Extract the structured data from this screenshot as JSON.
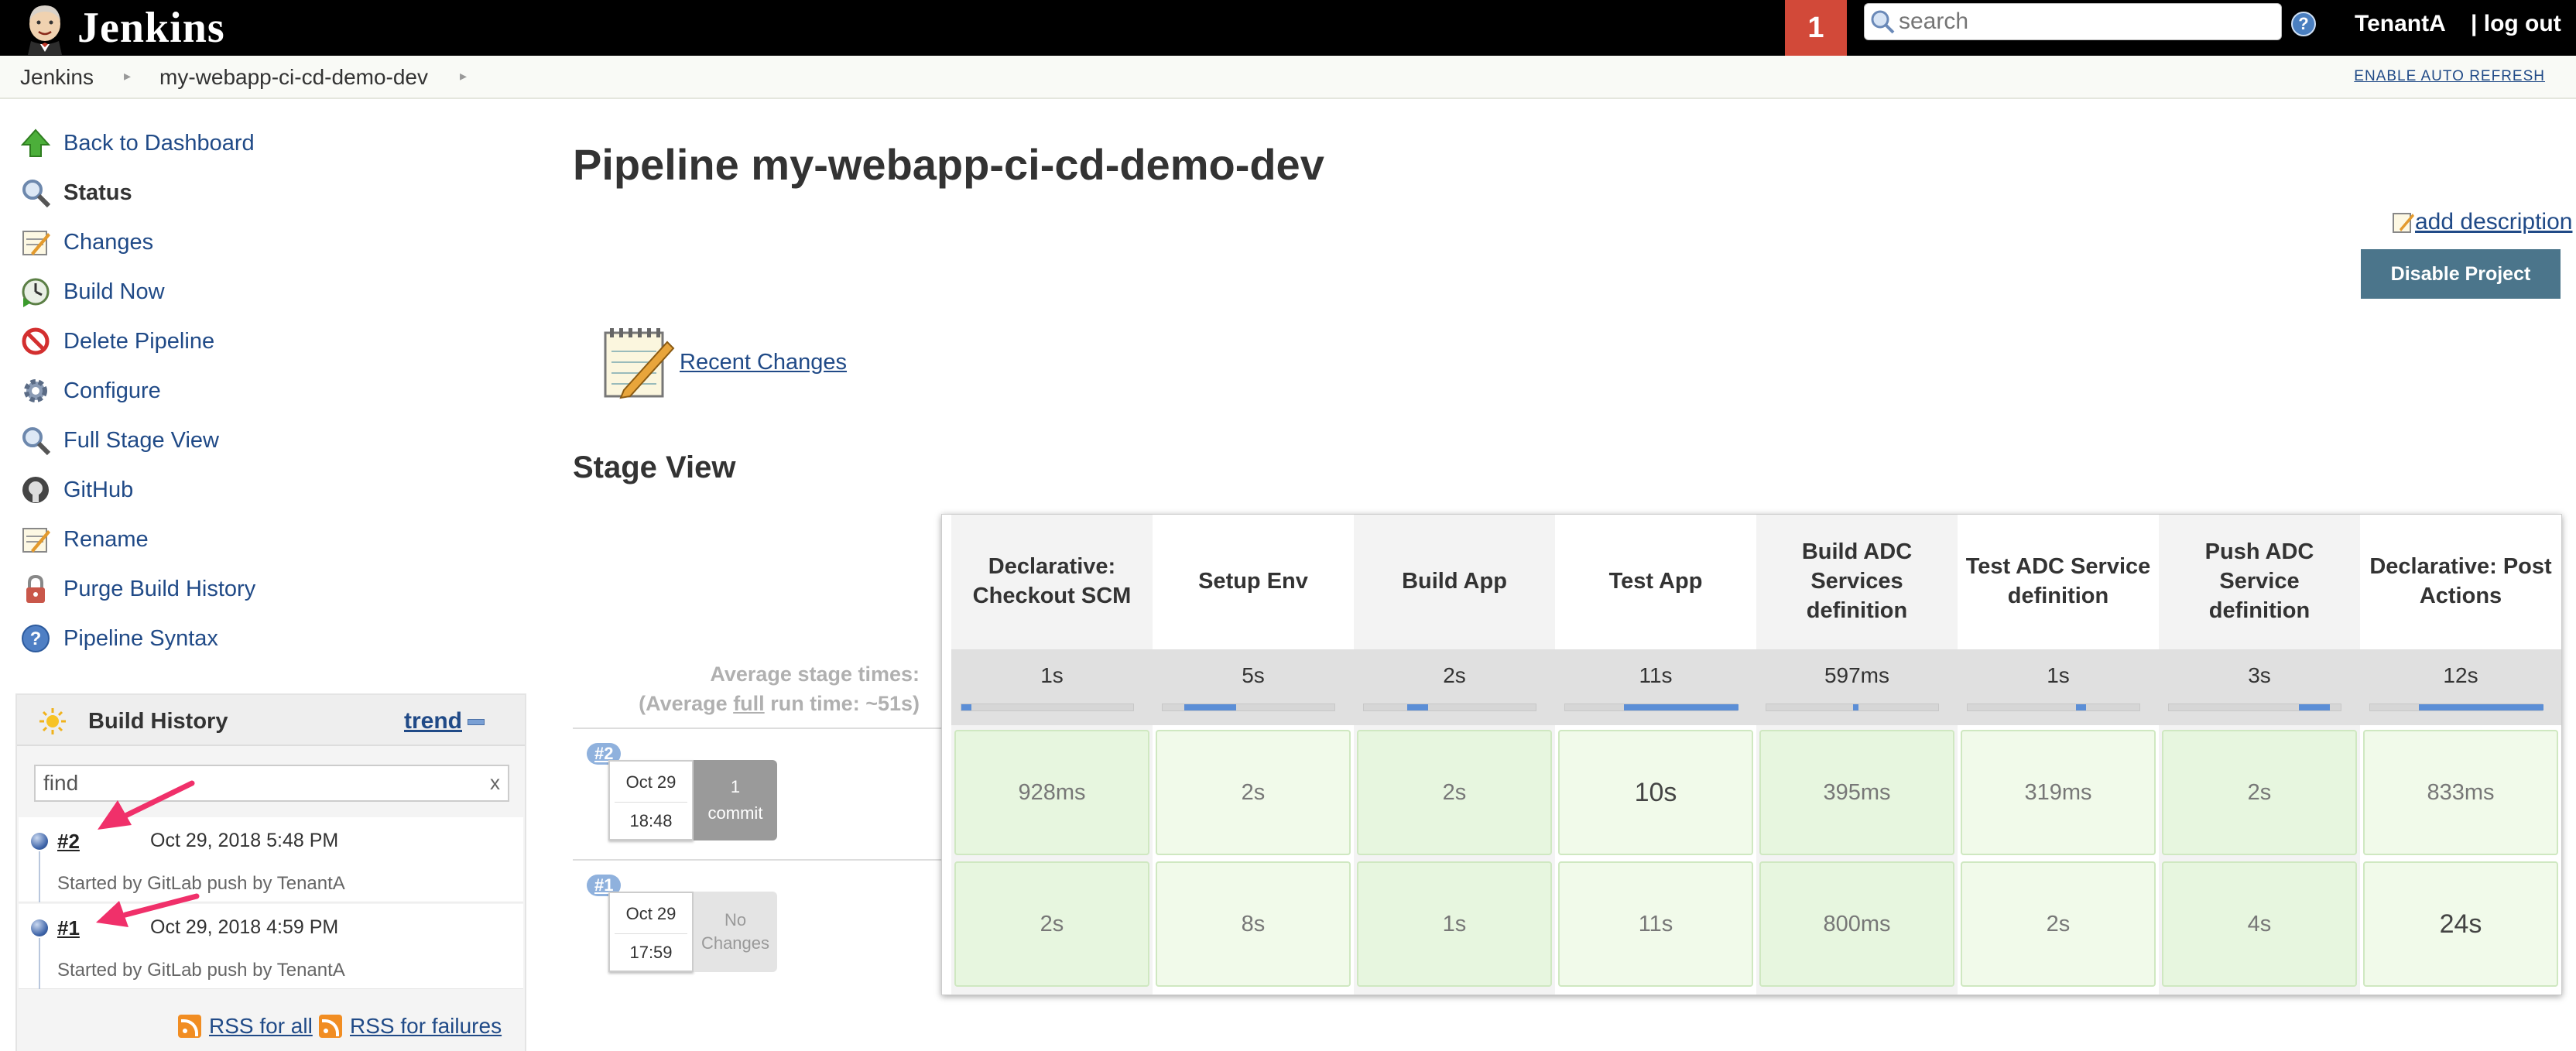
{
  "header": {
    "brand": "Jenkins",
    "notification_count": "1",
    "search_placeholder": "search",
    "help_label": "?",
    "user": "TenantA",
    "logout": "log out"
  },
  "breadcrumb": {
    "items": [
      "Jenkins",
      "my-webapp-ci-cd-demo-dev"
    ],
    "auto_refresh": "ENABLE AUTO REFRESH"
  },
  "sidebar": {
    "tasks": [
      {
        "label": "Back to Dashboard",
        "icon": "up-arrow-icon"
      },
      {
        "label": "Status",
        "icon": "magnifier-icon"
      },
      {
        "label": "Changes",
        "icon": "notepad-icon"
      },
      {
        "label": "Build Now",
        "icon": "clock-play-icon"
      },
      {
        "label": "Delete Pipeline",
        "icon": "no-entry-icon"
      },
      {
        "label": "Configure",
        "icon": "gear-icon"
      },
      {
        "label": "Full Stage View",
        "icon": "magnifier-icon"
      },
      {
        "label": "GitHub",
        "icon": "github-icon"
      },
      {
        "label": "Rename",
        "icon": "notepad-icon"
      },
      {
        "label": "Purge Build History",
        "icon": "lock-icon"
      },
      {
        "label": "Pipeline Syntax",
        "icon": "help-icon"
      }
    ]
  },
  "build_history": {
    "title": "Build History",
    "trend": "trend",
    "find_value": "find",
    "find_clear": "x",
    "builds": [
      {
        "number": "#2",
        "date": "Oct 29, 2018 5:48 PM",
        "cause": "Started by GitLab push by TenantA"
      },
      {
        "number": "#1",
        "date": "Oct 29, 2018 4:59 PM",
        "cause": "Started by GitLab push by TenantA"
      }
    ],
    "rss_all": "RSS for all",
    "rss_failures": "RSS for failures"
  },
  "main": {
    "title": "Pipeline my-webapp-ci-cd-demo-dev",
    "add_description": "add description",
    "disable_button": "Disable Project",
    "recent_changes": "Recent Changes",
    "stage_view_title": "Stage View",
    "avg_line1": "Average stage times:",
    "avg_line2_pre": "(Average ",
    "avg_line2_u": "full",
    "avg_line2_post": " run time: ~51s)"
  },
  "stage_view": {
    "stages": [
      {
        "name": "Declarative: Checkout SCM",
        "avg": "1s",
        "avg_bar_fraction": 0.02
      },
      {
        "name": "Setup Env",
        "avg": "5s",
        "avg_bar_fraction": 0.1
      },
      {
        "name": "Build App",
        "avg": "2s",
        "avg_bar_fraction": 0.04
      },
      {
        "name": "Test App",
        "avg": "11s",
        "avg_bar_fraction": 0.22
      },
      {
        "name": "Build ADC Services definition",
        "avg": "597ms",
        "avg_bar_fraction": 0.01
      },
      {
        "name": "Test ADC Service definition",
        "avg": "1s",
        "avg_bar_fraction": 0.02
      },
      {
        "name": "Push ADC Service definition",
        "avg": "3s",
        "avg_bar_fraction": 0.06
      },
      {
        "name": "Declarative: Post Actions",
        "avg": "12s",
        "avg_bar_fraction": 0.24
      }
    ],
    "runs": [
      {
        "badge": "#2",
        "date": "Oct 29",
        "time": "18:48",
        "changes": [
          "1",
          "commit"
        ],
        "changes_style": "dark",
        "durations": [
          "928ms",
          "2s",
          "2s",
          "10s",
          "395ms",
          "319ms",
          "2s",
          "833ms"
        ]
      },
      {
        "badge": "#1",
        "date": "Oct 29",
        "time": "17:59",
        "changes": [
          "No",
          "Changes"
        ],
        "changes_style": "light",
        "durations": [
          "2s",
          "8s",
          "1s",
          "11s",
          "800ms",
          "2s",
          "4s",
          "24s"
        ]
      }
    ]
  },
  "colors": {
    "header_bg": "#000000",
    "notification_bg": "#d24939",
    "link": "#204a87",
    "stage_cell_success": "#e7f6df",
    "disable_button_bg": "#4b758b",
    "annotation_arrow": "#f0306a"
  }
}
